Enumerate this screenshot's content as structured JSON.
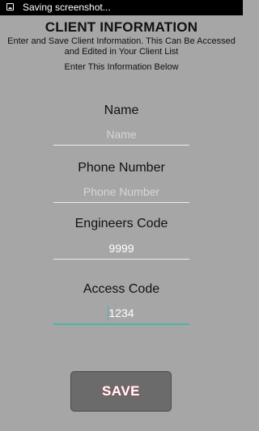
{
  "status_bar": {
    "icon": "screenshot-icon",
    "text": "Saving screenshot..."
  },
  "header": {
    "title": "CLIENT INFORMATION",
    "subtitle": "Enter and Save Client Information. This Can Be Accessed and Edited in Your Client List",
    "instruction": "Enter This Information Below"
  },
  "form": {
    "name": {
      "label": "Name",
      "placeholder": "Name",
      "value": ""
    },
    "phone": {
      "label": "Phone Number",
      "placeholder": "Phone Number",
      "value": ""
    },
    "engineers_code": {
      "label": "Engineers Code",
      "value": "9999"
    },
    "access_code": {
      "label": "Access Code",
      "value": "1234"
    }
  },
  "save_button": {
    "label": "SAVE"
  },
  "colors": {
    "background": "#a6a6a6",
    "accent": "#4fb3ac",
    "button": "#6b6b6b"
  }
}
